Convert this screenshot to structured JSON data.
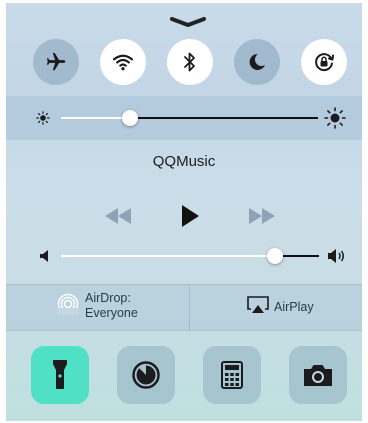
{
  "toggles": [
    {
      "name": "airplane-mode",
      "icon": "airplane-icon",
      "state": "off"
    },
    {
      "name": "wifi",
      "icon": "wifi-icon",
      "state": "on"
    },
    {
      "name": "bluetooth",
      "icon": "bluetooth-icon",
      "state": "on"
    },
    {
      "name": "do-not-disturb",
      "icon": "moon-icon",
      "state": "off"
    },
    {
      "name": "rotation-lock",
      "icon": "rotation-lock-icon",
      "state": "on"
    }
  ],
  "brightness": {
    "level": 0.27,
    "icons": [
      "sun-small-icon",
      "sun-large-icon"
    ]
  },
  "now_playing": {
    "app": "QQMusic"
  },
  "playback": {
    "prev_icon": "rewind-icon",
    "play_icon": "play-icon",
    "next_icon": "fast-forward-icon"
  },
  "volume": {
    "level": 0.83,
    "icons": [
      "speaker-low-icon",
      "speaker-high-icon"
    ]
  },
  "airdrop": {
    "label": "AirDrop:",
    "status": "Everyone",
    "icon": "airdrop-icon"
  },
  "airplay": {
    "label": "AirPlay",
    "icon": "airplay-icon"
  },
  "shortcuts": [
    {
      "name": "flashlight",
      "icon": "flashlight-icon",
      "active": true
    },
    {
      "name": "timer",
      "icon": "timer-icon",
      "active": false
    },
    {
      "name": "calculator",
      "icon": "calculator-icon",
      "active": false
    },
    {
      "name": "camera",
      "icon": "camera-icon",
      "active": false
    }
  ],
  "colors": {
    "on": "#ffffff",
    "off": "#7896af",
    "flashlight_active": "#4fe0c6",
    "text": "#1c1c1e"
  }
}
